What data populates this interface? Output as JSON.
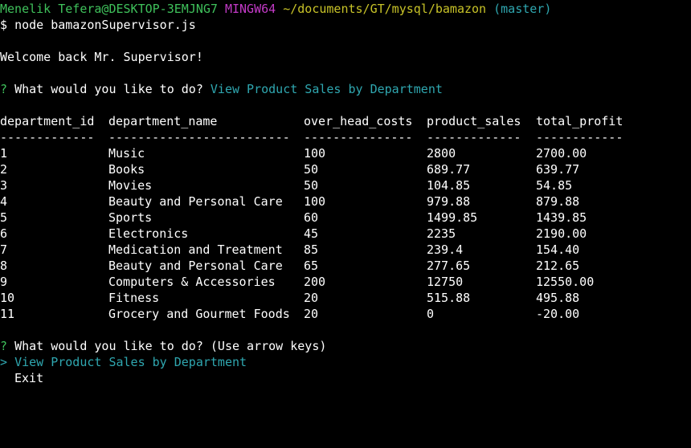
{
  "prompt_line": {
    "user": "Menelik Tefera@DESKTOP-3EMJNG7",
    "env": "MINGW64",
    "path": "~/documents/GT/mysql/bamazon",
    "branch": "(master)"
  },
  "command_line": {
    "symbol": "$",
    "command": "node bamazonSupervisor.js"
  },
  "welcome_text": "Welcome back Mr. Supervisor!",
  "question1": {
    "mark": "?",
    "text": "What would you like to do?",
    "answer": "View Product Sales by Department"
  },
  "table": {
    "headers": [
      "department_id",
      "department_name",
      "over_head_costs",
      "product_sales",
      "total_profit"
    ],
    "separators": [
      "-------------",
      "-------------------------",
      "---------------",
      "-------------",
      "------------"
    ],
    "rows": [
      [
        "1",
        "Music",
        "100",
        "2800",
        "2700.00"
      ],
      [
        "2",
        "Books",
        "50",
        "689.77",
        "639.77"
      ],
      [
        "3",
        "Movies",
        "50",
        "104.85",
        "54.85"
      ],
      [
        "4",
        "Beauty and Personal Care",
        "100",
        "979.88",
        "879.88"
      ],
      [
        "5",
        "Sports",
        "60",
        "1499.85",
        "1439.85"
      ],
      [
        "6",
        "Electronics",
        "45",
        "2235",
        "2190.00"
      ],
      [
        "7",
        "Medication and Treatment",
        "85",
        "239.4",
        "154.40"
      ],
      [
        "8",
        "Beauty and Personal Care",
        "65",
        "277.65",
        "212.65"
      ],
      [
        "9",
        "Computers & Accessories",
        "200",
        "12750",
        "12550.00"
      ],
      [
        "10",
        "Fitness",
        "20",
        "515.88",
        "495.88"
      ],
      [
        "11",
        "Grocery and Gourmet Foods",
        "20",
        "0",
        "-20.00"
      ]
    ]
  },
  "question2": {
    "mark": "?",
    "text": "What would you like to do?",
    "hint": "(Use arrow keys)"
  },
  "menu": {
    "pointer": ">",
    "selected": "View Product Sales by Department",
    "other": "Exit"
  },
  "colors": {
    "green": "#3fc15b",
    "magenta": "#c33ac7",
    "yellow": "#c8c328",
    "cyan": "#2fa7b0",
    "background": "#000000"
  }
}
